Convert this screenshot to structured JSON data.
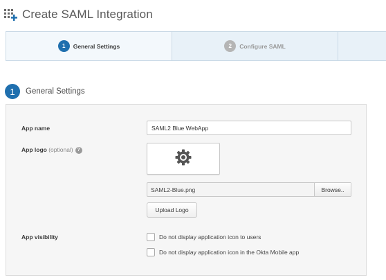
{
  "header": {
    "title": "Create SAML Integration",
    "icon": "apps-add-icon"
  },
  "wizard": {
    "steps": [
      {
        "number": "1",
        "label": "General Settings",
        "state": "active"
      },
      {
        "number": "2",
        "label": "Configure SAML",
        "state": "inactive"
      }
    ]
  },
  "section": {
    "number": "1",
    "title": "General Settings"
  },
  "form": {
    "app_name_label": "App name",
    "app_name_value": "SAML2 Blue WebApp",
    "app_logo_label": "App logo",
    "app_logo_optional": "(optional)",
    "help_glyph": "?",
    "logo_icon": "gear-icon",
    "file_name": "SAML2-Blue.png",
    "browse_label": "Browse..",
    "upload_label": "Upload Logo",
    "visibility_label": "App visibility",
    "visibility_options": [
      {
        "label": "Do not display application icon to users",
        "checked": false
      },
      {
        "label": "Do not display application icon in the Okta Mobile app",
        "checked": false
      }
    ]
  },
  "colors": {
    "accent": "#1f6fae",
    "inactive_step": "#b5b5b5",
    "wizard_bg": "#e8f1f8"
  }
}
